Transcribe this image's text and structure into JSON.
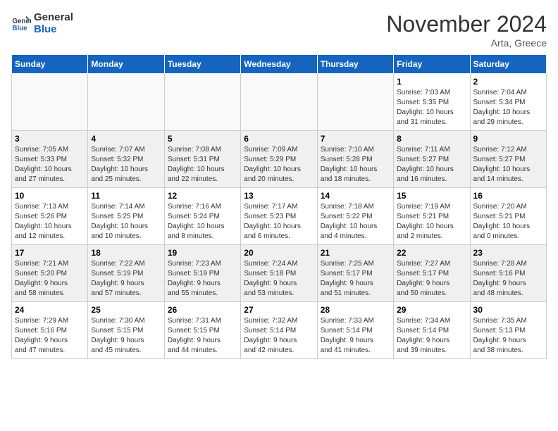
{
  "header": {
    "logo_line1": "General",
    "logo_line2": "Blue",
    "month": "November 2024",
    "location": "Arta, Greece"
  },
  "days_of_week": [
    "Sunday",
    "Monday",
    "Tuesday",
    "Wednesday",
    "Thursday",
    "Friday",
    "Saturday"
  ],
  "weeks": [
    {
      "shaded": false,
      "days": [
        {
          "num": "",
          "info": ""
        },
        {
          "num": "",
          "info": ""
        },
        {
          "num": "",
          "info": ""
        },
        {
          "num": "",
          "info": ""
        },
        {
          "num": "",
          "info": ""
        },
        {
          "num": "1",
          "info": "Sunrise: 7:03 AM\nSunset: 5:35 PM\nDaylight: 10 hours\nand 31 minutes."
        },
        {
          "num": "2",
          "info": "Sunrise: 7:04 AM\nSunset: 5:34 PM\nDaylight: 10 hours\nand 29 minutes."
        }
      ]
    },
    {
      "shaded": true,
      "days": [
        {
          "num": "3",
          "info": "Sunrise: 7:05 AM\nSunset: 5:33 PM\nDaylight: 10 hours\nand 27 minutes."
        },
        {
          "num": "4",
          "info": "Sunrise: 7:07 AM\nSunset: 5:32 PM\nDaylight: 10 hours\nand 25 minutes."
        },
        {
          "num": "5",
          "info": "Sunrise: 7:08 AM\nSunset: 5:31 PM\nDaylight: 10 hours\nand 22 minutes."
        },
        {
          "num": "6",
          "info": "Sunrise: 7:09 AM\nSunset: 5:29 PM\nDaylight: 10 hours\nand 20 minutes."
        },
        {
          "num": "7",
          "info": "Sunrise: 7:10 AM\nSunset: 5:28 PM\nDaylight: 10 hours\nand 18 minutes."
        },
        {
          "num": "8",
          "info": "Sunrise: 7:11 AM\nSunset: 5:27 PM\nDaylight: 10 hours\nand 16 minutes."
        },
        {
          "num": "9",
          "info": "Sunrise: 7:12 AM\nSunset: 5:27 PM\nDaylight: 10 hours\nand 14 minutes."
        }
      ]
    },
    {
      "shaded": false,
      "days": [
        {
          "num": "10",
          "info": "Sunrise: 7:13 AM\nSunset: 5:26 PM\nDaylight: 10 hours\nand 12 minutes."
        },
        {
          "num": "11",
          "info": "Sunrise: 7:14 AM\nSunset: 5:25 PM\nDaylight: 10 hours\nand 10 minutes."
        },
        {
          "num": "12",
          "info": "Sunrise: 7:16 AM\nSunset: 5:24 PM\nDaylight: 10 hours\nand 8 minutes."
        },
        {
          "num": "13",
          "info": "Sunrise: 7:17 AM\nSunset: 5:23 PM\nDaylight: 10 hours\nand 6 minutes."
        },
        {
          "num": "14",
          "info": "Sunrise: 7:18 AM\nSunset: 5:22 PM\nDaylight: 10 hours\nand 4 minutes."
        },
        {
          "num": "15",
          "info": "Sunrise: 7:19 AM\nSunset: 5:21 PM\nDaylight: 10 hours\nand 2 minutes."
        },
        {
          "num": "16",
          "info": "Sunrise: 7:20 AM\nSunset: 5:21 PM\nDaylight: 10 hours\nand 0 minutes."
        }
      ]
    },
    {
      "shaded": true,
      "days": [
        {
          "num": "17",
          "info": "Sunrise: 7:21 AM\nSunset: 5:20 PM\nDaylight: 9 hours\nand 58 minutes."
        },
        {
          "num": "18",
          "info": "Sunrise: 7:22 AM\nSunset: 5:19 PM\nDaylight: 9 hours\nand 57 minutes."
        },
        {
          "num": "19",
          "info": "Sunrise: 7:23 AM\nSunset: 5:19 PM\nDaylight: 9 hours\nand 55 minutes."
        },
        {
          "num": "20",
          "info": "Sunrise: 7:24 AM\nSunset: 5:18 PM\nDaylight: 9 hours\nand 53 minutes."
        },
        {
          "num": "21",
          "info": "Sunrise: 7:25 AM\nSunset: 5:17 PM\nDaylight: 9 hours\nand 51 minutes."
        },
        {
          "num": "22",
          "info": "Sunrise: 7:27 AM\nSunset: 5:17 PM\nDaylight: 9 hours\nand 50 minutes."
        },
        {
          "num": "23",
          "info": "Sunrise: 7:28 AM\nSunset: 5:16 PM\nDaylight: 9 hours\nand 48 minutes."
        }
      ]
    },
    {
      "shaded": false,
      "days": [
        {
          "num": "24",
          "info": "Sunrise: 7:29 AM\nSunset: 5:16 PM\nDaylight: 9 hours\nand 47 minutes."
        },
        {
          "num": "25",
          "info": "Sunrise: 7:30 AM\nSunset: 5:15 PM\nDaylight: 9 hours\nand 45 minutes."
        },
        {
          "num": "26",
          "info": "Sunrise: 7:31 AM\nSunset: 5:15 PM\nDaylight: 9 hours\nand 44 minutes."
        },
        {
          "num": "27",
          "info": "Sunrise: 7:32 AM\nSunset: 5:14 PM\nDaylight: 9 hours\nand 42 minutes."
        },
        {
          "num": "28",
          "info": "Sunrise: 7:33 AM\nSunset: 5:14 PM\nDaylight: 9 hours\nand 41 minutes."
        },
        {
          "num": "29",
          "info": "Sunrise: 7:34 AM\nSunset: 5:14 PM\nDaylight: 9 hours\nand 39 minutes."
        },
        {
          "num": "30",
          "info": "Sunrise: 7:35 AM\nSunset: 5:13 PM\nDaylight: 9 hours\nand 38 minutes."
        }
      ]
    }
  ]
}
